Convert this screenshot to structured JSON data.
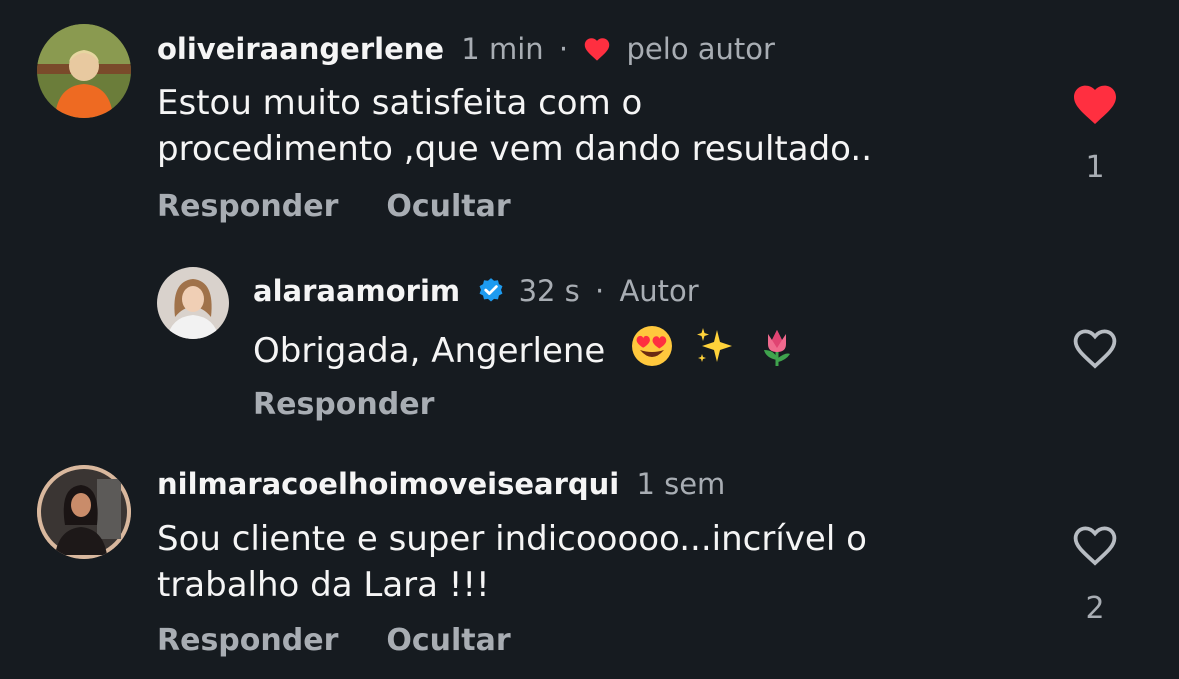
{
  "comments": [
    {
      "username": "oliveiraangerlene",
      "time": "1 min",
      "author_like": "pelo autor",
      "text_line1": "Estou muito satisfeita com o",
      "text_line2": "procedimento ,que vem dando resultado..",
      "reply_label": "Responder",
      "hide_label": "Ocultar",
      "like_count": "1",
      "liked": true
    },
    {
      "username": "alaraamorim",
      "time": "32 s",
      "role": "Autor",
      "text": "Obrigada, Angerlene",
      "emojis": [
        "smiling-face-with-heart-eyes",
        "sparkles",
        "tulip"
      ],
      "reply_label": "Responder",
      "liked": false
    },
    {
      "username": "nilmaracoelhoimoveisearqui",
      "time": "1 sem",
      "text_line1": "Sou cliente e super indicooooo...incrível o",
      "text_line2": "trabalho da Lara !!!",
      "reply_label": "Responder",
      "hide_label": "Ocultar",
      "like_count": "2",
      "liked": false
    }
  ],
  "colors": {
    "background": "#161b20",
    "text": "#f5f5f5",
    "muted": "#a8adb3",
    "like_red": "#ff2f40",
    "verified_blue": "#1d9bf0"
  }
}
